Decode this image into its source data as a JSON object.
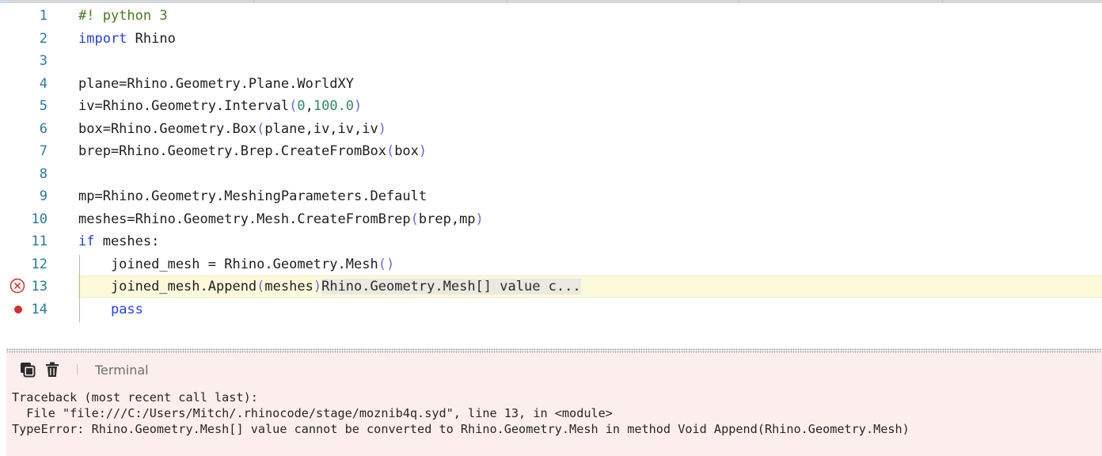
{
  "editor": {
    "lines": [
      {
        "no": "1",
        "tokens": [
          {
            "t": "#! python 3",
            "c": "com"
          }
        ]
      },
      {
        "no": "2",
        "tokens": [
          {
            "t": "import",
            "c": "kw"
          },
          {
            "t": " Rhino",
            "c": ""
          }
        ]
      },
      {
        "no": "3",
        "tokens": []
      },
      {
        "no": "4",
        "tokens": [
          {
            "t": "plane=Rhino.Geometry.Plane.WorldXY",
            "c": ""
          }
        ]
      },
      {
        "no": "5",
        "tokens": [
          {
            "t": "iv=Rhino.Geometry.Interval",
            "c": ""
          },
          {
            "t": "(",
            "c": "par"
          },
          {
            "t": "0",
            "c": "num"
          },
          {
            "t": ",",
            "c": ""
          },
          {
            "t": "100.0",
            "c": "num"
          },
          {
            "t": ")",
            "c": "par"
          }
        ]
      },
      {
        "no": "6",
        "tokens": [
          {
            "t": "box=Rhino.Geometry.Box",
            "c": ""
          },
          {
            "t": "(",
            "c": "par"
          },
          {
            "t": "plane,iv,iv,iv",
            "c": ""
          },
          {
            "t": ")",
            "c": "par"
          }
        ]
      },
      {
        "no": "7",
        "tokens": [
          {
            "t": "brep=Rhino.Geometry.Brep.CreateFromBox",
            "c": ""
          },
          {
            "t": "(",
            "c": "par"
          },
          {
            "t": "box",
            "c": ""
          },
          {
            "t": ")",
            "c": "par"
          }
        ]
      },
      {
        "no": "8",
        "tokens": []
      },
      {
        "no": "9",
        "tokens": [
          {
            "t": "mp=Rhino.Geometry.MeshingParameters.Default",
            "c": ""
          }
        ]
      },
      {
        "no": "10",
        "tokens": [
          {
            "t": "meshes=Rhino.Geometry.Mesh.CreateFromBrep",
            "c": ""
          },
          {
            "t": "(",
            "c": "par"
          },
          {
            "t": "brep,mp",
            "c": ""
          },
          {
            "t": ")",
            "c": "par"
          }
        ]
      },
      {
        "no": "11",
        "tokens": [
          {
            "t": "if",
            "c": "kw"
          },
          {
            "t": " meshes:",
            "c": ""
          }
        ]
      },
      {
        "no": "12",
        "tokens": [
          {
            "t": "    joined_mesh = Rhino.Geometry.Mesh",
            "c": ""
          },
          {
            "t": "()",
            "c": "par"
          }
        ]
      },
      {
        "no": "13",
        "marker": "error",
        "highlight": true,
        "tokens": [
          {
            "t": "    joined_mesh.Append",
            "c": ""
          },
          {
            "t": "(",
            "c": "par"
          },
          {
            "t": "meshes",
            "c": ""
          },
          {
            "t": ")",
            "c": "par"
          },
          {
            "t": "Rhino.Geometry.Mesh[] value c...",
            "c": "inline-hint"
          }
        ]
      },
      {
        "no": "14",
        "marker": "breakpoint",
        "tokens": [
          {
            "t": "    ",
            "c": ""
          },
          {
            "t": "pass",
            "c": "kw"
          }
        ]
      }
    ]
  },
  "terminal": {
    "title": "Terminal",
    "icons": [
      "copy-icon",
      "trash-icon"
    ],
    "output": [
      "Traceback (most recent call last):",
      "  File \"file:///C:/Users/Mitch/.rhinocode/stage/moznib4q.syd\", line 13, in <module>",
      "TypeError: Rhino.Geometry.Mesh[] value cannot be converted to Rhino.Geometry.Mesh in method Void Append(Rhino.Geometry.Mesh)"
    ]
  }
}
